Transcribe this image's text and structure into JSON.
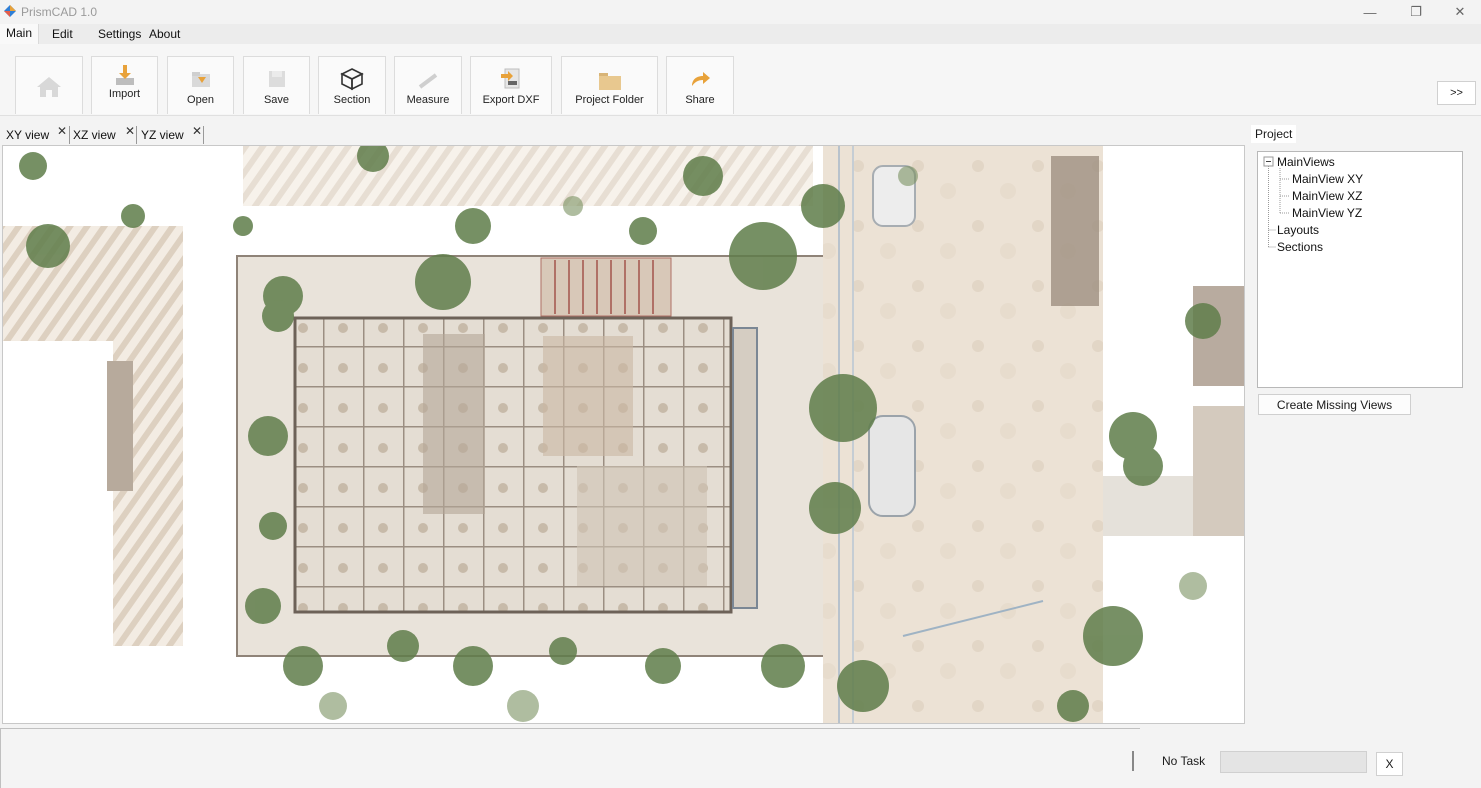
{
  "app": {
    "title": "PrismCAD 1.0"
  },
  "window_controls": {
    "minimize": "—",
    "restore": "❐",
    "close": "✕"
  },
  "menu": [
    {
      "label": "Main",
      "active": true
    },
    {
      "label": "Edit"
    },
    {
      "label": "Settings"
    },
    {
      "label": "About"
    }
  ],
  "ribbon": {
    "buttons": [
      {
        "label": "",
        "icon": "home-icon"
      },
      {
        "label": "Import",
        "icon": "import-icon"
      },
      {
        "label": "Open",
        "icon": "open-icon"
      },
      {
        "label": "Save",
        "icon": "save-icon"
      },
      {
        "label": "Section",
        "icon": "section-cube-icon"
      },
      {
        "label": "Measure",
        "icon": "measure-icon"
      },
      {
        "label": "Export DXF",
        "icon": "export-dxf-icon"
      },
      {
        "label": "Project Folder",
        "icon": "folder-icon"
      },
      {
        "label": "Share",
        "icon": "share-icon"
      }
    ],
    "more": ">>"
  },
  "tabs": [
    {
      "label": "XY view",
      "close": "✕"
    },
    {
      "label": "XZ view",
      "close": "✕"
    },
    {
      "label": "YZ view",
      "close": "✕"
    }
  ],
  "project": {
    "title": "Project",
    "tree": {
      "root": "MainViews",
      "expander": "−",
      "children": [
        "MainView XY",
        "MainView XZ",
        "MainView YZ"
      ],
      "siblings": [
        "Layouts",
        "Sections"
      ]
    },
    "create_button": "Create Missing Views"
  },
  "status": {
    "task": "No Task",
    "cancel": "X",
    "progress": 0
  },
  "colors": {
    "accent_orange": "#e8a23a",
    "accent_blue": "#2f7fd6",
    "tree_line": "#9a9a9a"
  }
}
